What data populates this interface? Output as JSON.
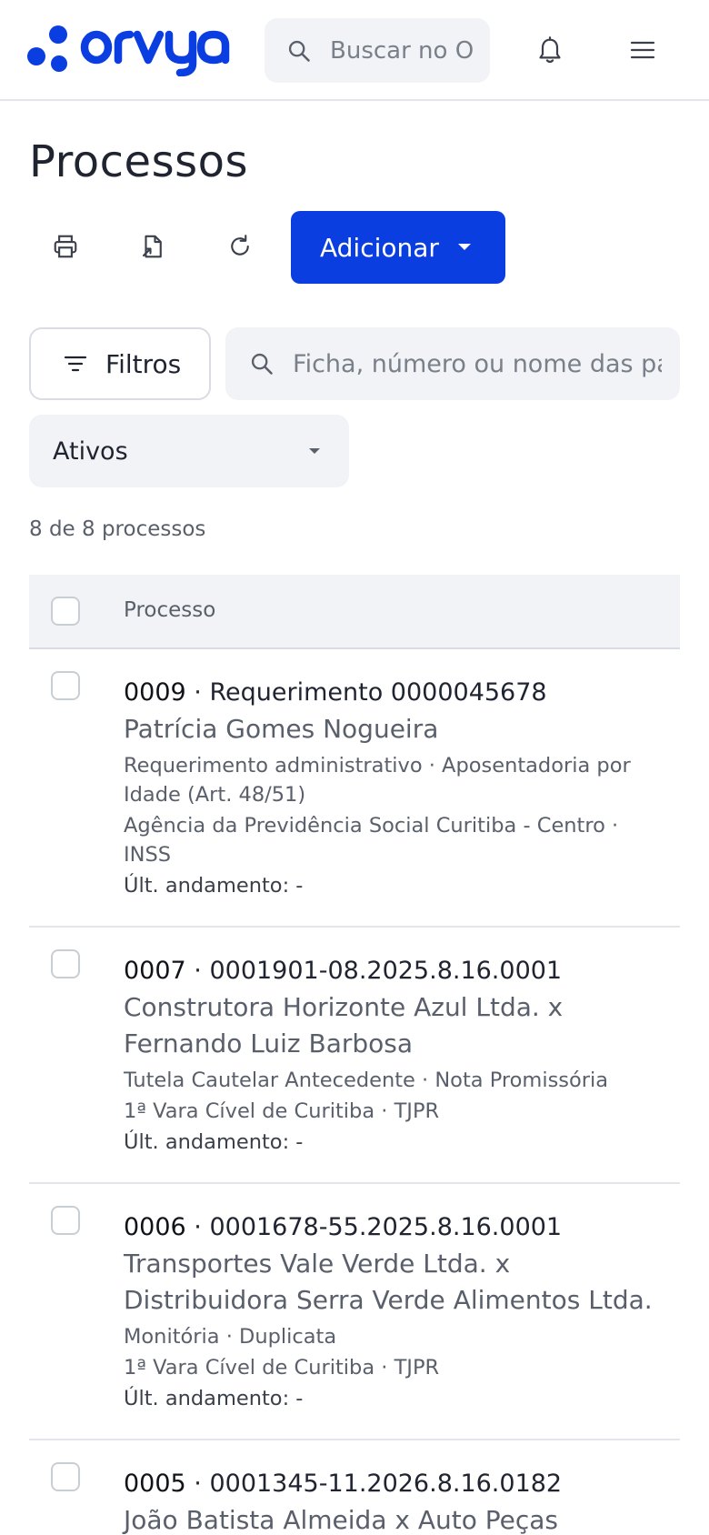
{
  "header": {
    "logo_text": "orvya",
    "search_placeholder": "Buscar no Orvya"
  },
  "page": {
    "title": "Processos",
    "add_button": "Adicionar",
    "filters_button": "Filtros",
    "list_search_placeholder": "Ficha, número ou nome das partes",
    "status_selected": "Ativos",
    "count_text": "8 de 8 processos",
    "column_header": "Processo"
  },
  "rows": [
    {
      "code": "0009",
      "number": "Requerimento 0000045678",
      "parties": "Patrícia Gomes Nogueira",
      "meta": "Requerimento administrativo · Aposentadoria por Idade (Art. 48/51)",
      "court": "Agência da Previdência Social Curitiba - Centro · INSS",
      "last_update": "Últ. andamento: -"
    },
    {
      "code": "0007",
      "number": "0001901-08.2025.8.16.0001",
      "parties": "Construtora Horizonte Azul Ltda. x Fernando Luiz Barbosa",
      "meta": "Tutela Cautelar Antecedente · Nota Promissória",
      "court": "1ª Vara Cível de Curitiba · TJPR",
      "last_update": "Últ. andamento: -"
    },
    {
      "code": "0006",
      "number": "0001678-55.2025.8.16.0001",
      "parties": "Transportes Vale Verde Ltda. x Distribuidora Serra Verde Alimentos Ltda.",
      "meta": "Monitória · Duplicata",
      "court": "1ª Vara Cível de Curitiba · TJPR",
      "last_update": "Últ. andamento: -"
    },
    {
      "code": "0005",
      "number": "0001345-11.2026.8.16.0182",
      "parties": "João Batista Almeida x Auto Peças",
      "meta": "",
      "court": "",
      "last_update": ""
    }
  ],
  "colors": {
    "primary": "#0a3ee0",
    "text": "#1f2430",
    "muted": "#5a606b",
    "surface": "#f2f3f6",
    "border": "#d9dce2"
  },
  "icons": {
    "search": "search-icon",
    "bell": "bell-icon",
    "menu": "hamburger-menu-icon",
    "print": "printer-icon",
    "export": "file-export-icon",
    "refresh": "refresh-icon",
    "filter": "filter-icon",
    "caret": "caret-down-icon"
  }
}
